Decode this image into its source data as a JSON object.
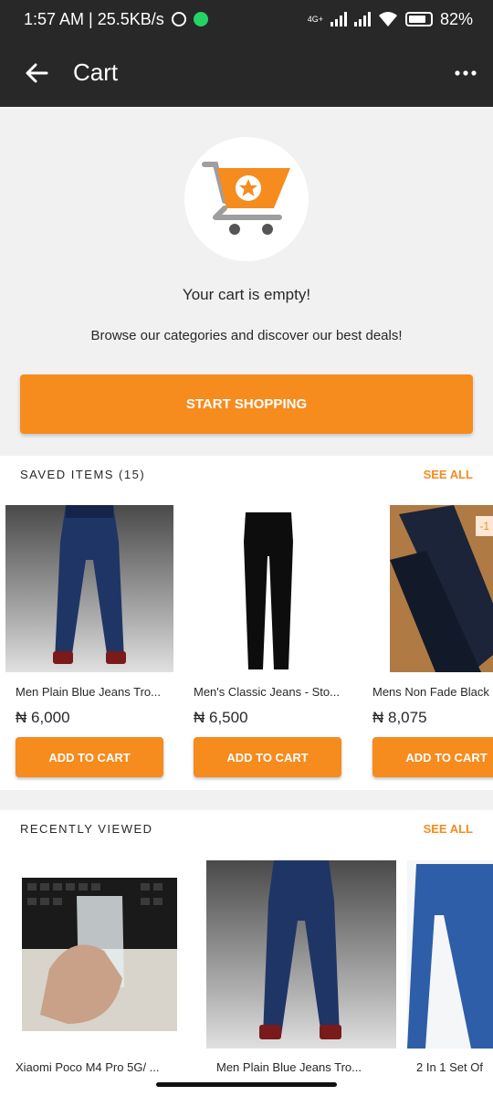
{
  "status": {
    "time": "1:57 AM | 25.5KB/s",
    "network": "4G+",
    "battery": "82%"
  },
  "appbar": {
    "title": "Cart",
    "back_icon": "arrow-left-icon",
    "more_icon": "more-dots-icon"
  },
  "empty": {
    "title": "Your cart is empty!",
    "subtitle": "Browse our categories and discover our best deals!",
    "button": "START SHOPPING"
  },
  "saved": {
    "title": "SAVED ITEMS (15)",
    "see_all": "SEE ALL",
    "items": [
      {
        "name": "Men Plain Blue Jeans Tro...",
        "price": "₦ 6,000",
        "button": "ADD TO CART"
      },
      {
        "name": "Men's Classic Jeans - Sto...",
        "price": "₦ 6,500",
        "button": "ADD TO CART"
      },
      {
        "name": "Mens Non Fade  Black",
        "price": "₦ 8,075",
        "button": "ADD TO CART",
        "badge": "-1"
      }
    ]
  },
  "recent": {
    "title": "RECENTLY VIEWED",
    "see_all": "SEE ALL",
    "items": [
      {
        "name": "Xiaomi Poco M4 Pro 5G/ ..."
      },
      {
        "name": "Men Plain Blue Jeans Tro..."
      },
      {
        "name": "2 In 1 Set Of"
      }
    ]
  },
  "colors": {
    "accent": "#f68b1e",
    "appbar": "#282828",
    "background": "#f1f1f2"
  }
}
